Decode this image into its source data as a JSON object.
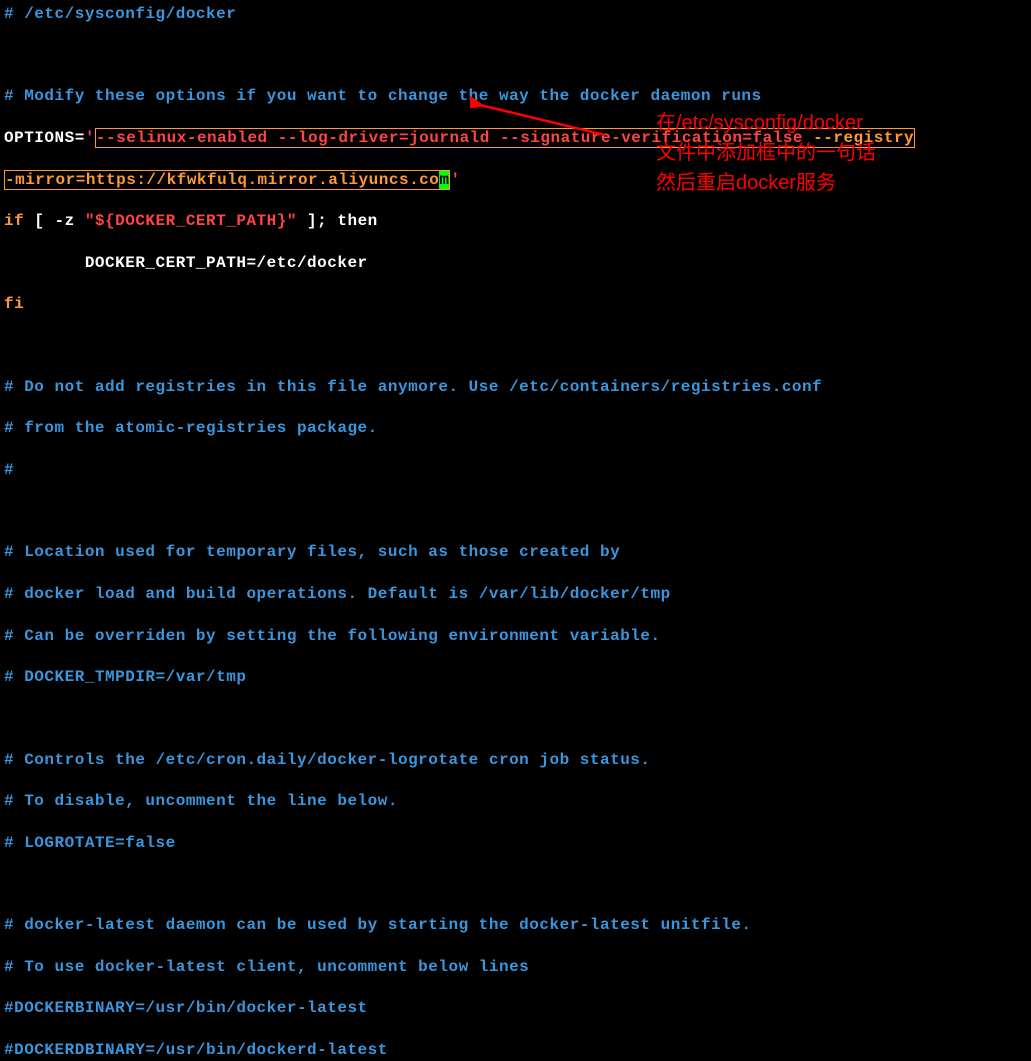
{
  "lines": {
    "l1": "# /etc/sysconfig/docker",
    "l2": "",
    "l3": "# Modify these options if you want to change the way the docker daemon runs",
    "l4_prefix": "OPTIONS=",
    "l4_quote": "'",
    "l4_content1": "--selinux-enabled --log-driver=journald --signature-verification=false ",
    "l4_content2": "--registry",
    "l5_content": "-mirror=https://kfwkfulq.mirror.aliyuncs.co",
    "l5_cursor": "m",
    "l5_quote_end": "'",
    "l6_if": "if",
    "l6_bracket": " [ -z ",
    "l6_var": "\"${DOCKER_CERT_PATH}\"",
    "l6_end": " ]; then",
    "l7": "        DOCKER_CERT_PATH=/etc/docker",
    "l8": "fi",
    "l9": "",
    "l10": "# Do not add registries in this file anymore. Use /etc/containers/registries.conf",
    "l11": "# from the atomic-registries package.",
    "l12": "#",
    "l13": "",
    "l14": "# Location used for temporary files, such as those created by",
    "l15": "# docker load and build operations. Default is /var/lib/docker/tmp",
    "l16": "# Can be overriden by setting the following environment variable.",
    "l17": "# DOCKER_TMPDIR=/var/tmp",
    "l18": "",
    "l19": "# Controls the /etc/cron.daily/docker-logrotate cron job status.",
    "l20": "# To disable, uncomment the line below.",
    "l21": "# LOGROTATE=false",
    "l22": "",
    "l23": "# docker-latest daemon can be used by starting the docker-latest unitfile.",
    "l24": "# To use docker-latest client, uncomment below lines",
    "l25": "#DOCKERBINARY=/usr/bin/docker-latest",
    "l26": "#DOCKERDBINARY=/usr/bin/dockerd-latest"
  },
  "annotation": {
    "line1": "在/etc/sysconfig/docker",
    "line2": "文件中添加框中的一句话",
    "line3": "然后重启docker服务"
  }
}
